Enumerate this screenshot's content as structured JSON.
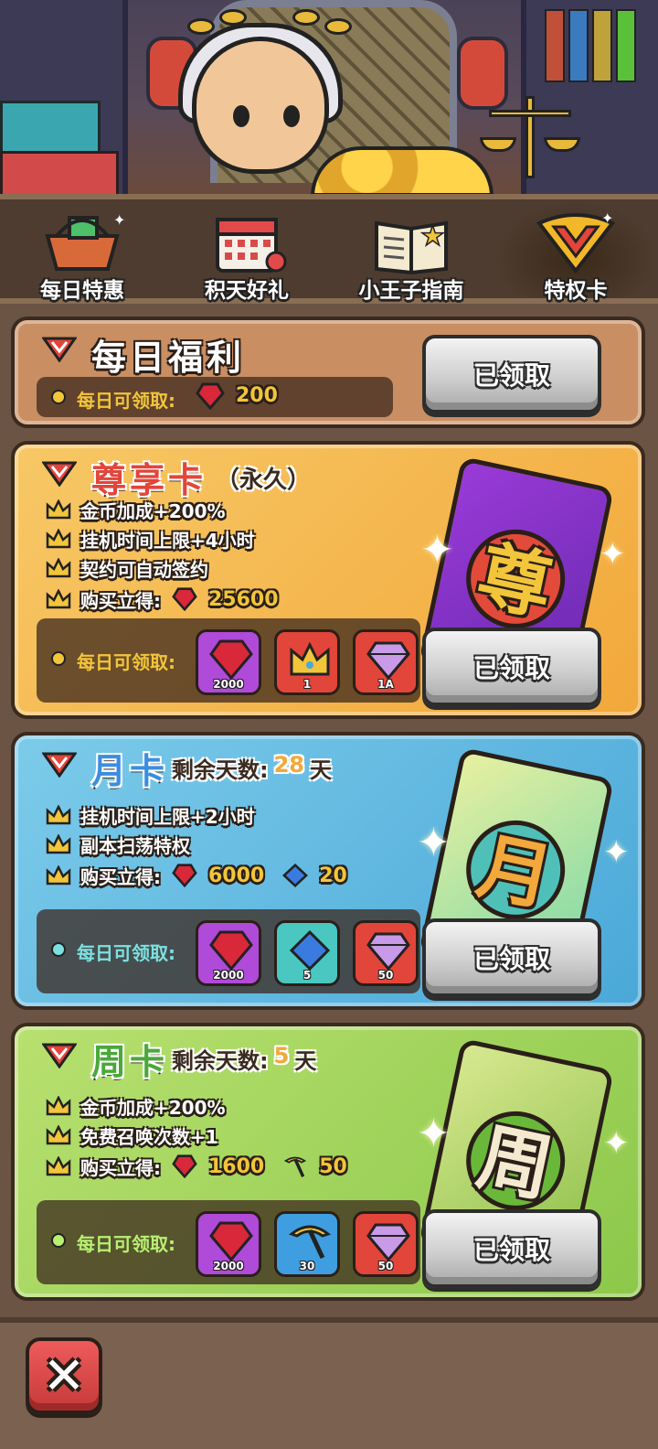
{
  "tabs": [
    {
      "label": "每日特惠",
      "icon": "shopping-basket-icon"
    },
    {
      "label": "积天好礼",
      "icon": "calendar-gift-icon"
    },
    {
      "label": "小王子指南",
      "icon": "guide-book-icon"
    },
    {
      "label": "特权卡",
      "icon": "privilege-v-icon",
      "active": true
    }
  ],
  "daily_welfare": {
    "title": "每日福利",
    "daily_label": "每日可领取:",
    "daily_amount": "200",
    "button": "已领取"
  },
  "premium_card": {
    "title": "尊享卡",
    "duration": "（永久）",
    "perks": [
      "金币加成+200%",
      "挂机时间上限+4小时",
      "契约可自动签约"
    ],
    "purchase_label": "购买立得:",
    "purchase_amount": "25600",
    "daily_label": "每日可领取:",
    "rewards": [
      {
        "icon": "ruby-icon",
        "count": "2000",
        "color": "#b04ad8"
      },
      {
        "icon": "crown-icon",
        "count": "1",
        "color": "#e2453a"
      },
      {
        "icon": "diamond-icon",
        "count": "1A",
        "color": "#e2453a"
      }
    ],
    "button": "已领取",
    "card_glyph": "尊"
  },
  "monthly_card": {
    "title": "月卡",
    "remaining_label": "剩余天数:",
    "remaining_days": "28",
    "days_unit": "天",
    "perks": [
      "挂机时间上限+2小时",
      "副本扫荡特权"
    ],
    "purchase_label": "购买立得:",
    "purchase_ruby": "6000",
    "purchase_sapphire": "20",
    "daily_label": "每日可领取:",
    "rewards": [
      {
        "icon": "ruby-icon",
        "count": "2000",
        "color": "#b04ad8"
      },
      {
        "icon": "sapphire-icon",
        "count": "5",
        "color": "#49c7c0"
      },
      {
        "icon": "diamond-icon",
        "count": "50",
        "color": "#e2453a"
      }
    ],
    "button": "已领取",
    "card_glyph": "月"
  },
  "weekly_card": {
    "title": "周卡",
    "remaining_label": "剩余天数:",
    "remaining_days": "5",
    "days_unit": "天",
    "perks": [
      "金币加成+200%",
      "免费召唤次数+1"
    ],
    "purchase_label": "购买立得:",
    "purchase_ruby": "1600",
    "purchase_pickaxe": "50",
    "daily_label": "每日可领取:",
    "rewards": [
      {
        "icon": "ruby-icon",
        "count": "2000",
        "color": "#b04ad8"
      },
      {
        "icon": "pickaxe-icon",
        "count": "30",
        "color": "#3f9ee0"
      },
      {
        "icon": "diamond-icon",
        "count": "50",
        "color": "#e2453a"
      }
    ],
    "button": "已领取",
    "card_glyph": "周"
  },
  "close_label": "✕",
  "colors": {
    "welfare_bg": "#c98e62",
    "premium_bg": "#f2b24a",
    "monthly_bg": "#5eb6de",
    "weekly_bg": "#9fd45a",
    "ruby": "#d8283a",
    "accent_gold": "#f2c53a"
  }
}
